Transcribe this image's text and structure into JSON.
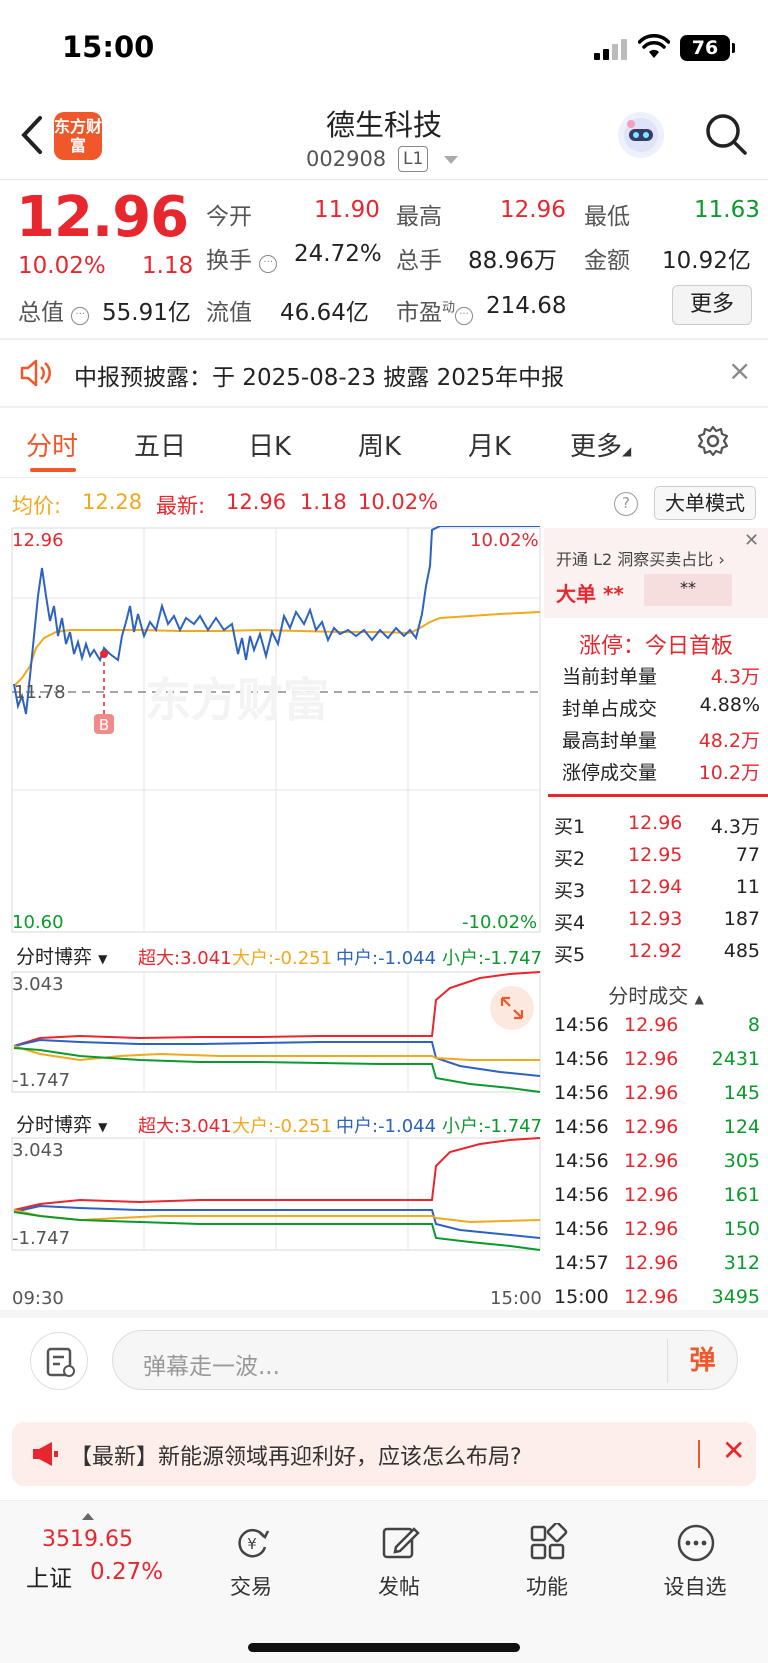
{
  "status": {
    "time": "15:00",
    "battery": "76"
  },
  "header": {
    "name": "德生科技",
    "code": "002908",
    "level": "L1",
    "logo": "东方财富"
  },
  "quote": {
    "price": "12.96",
    "pct": "10.02%",
    "change": "1.18",
    "open_label": "今开",
    "open": "11.90",
    "high_label": "最高",
    "high": "12.96",
    "low_label": "最低",
    "low": "11.63",
    "turnover_label": "换手",
    "turnover": "24.72%",
    "volume_label": "总手",
    "volume": "88.96万",
    "amount_label": "金额",
    "amount": "10.92亿",
    "mcap_label": "总值",
    "mcap": "55.91亿",
    "float_label": "流值",
    "float": "46.64亿",
    "pe_label": "市盈",
    "pe_sup": "动",
    "pe": "214.68",
    "more": "更多"
  },
  "notice": {
    "text": "中报预披露：于 2025-08-23 披露 2025年中报"
  },
  "tabs": [
    "分时",
    "五日",
    "日K",
    "周K",
    "月K",
    "更多"
  ],
  "info": {
    "avg_label": "均价:",
    "avg": "12.28",
    "latest_label": "最新:",
    "latest": "12.96",
    "chg": "1.18",
    "pct": "10.02%",
    "mode": "大单模式"
  },
  "chart": {
    "top_price": "12.96",
    "top_pct": "10.02%",
    "bottom_price": "10.60",
    "bottom_pct": "-10.02%",
    "mid_label": "11.78",
    "watermark": "东方财富",
    "marker": "B",
    "start_time": "09:30",
    "end_time": "15:00"
  },
  "flow": {
    "title": "分时博弈",
    "super": "超大:3.041",
    "large": "大户:-0.251",
    "mid": "中户:-1.044",
    "small": "小户:-1.747",
    "max": "3.043",
    "min": "-1.747"
  },
  "panel": {
    "l2_title": "开通 L2 洞察买卖占比",
    "big_order": "大单",
    "mask1": "**",
    "mask2": "**",
    "limit_title": "涨停：今日首板",
    "limit_rows": [
      {
        "label": "当前封单量",
        "value": "4.3万"
      },
      {
        "label": "封单占成交",
        "value": "4.88%"
      },
      {
        "label": "最高封单量",
        "value": "48.2万"
      },
      {
        "label": "涨停成交量",
        "value": "10.2万"
      }
    ],
    "bids": [
      {
        "label": "买1",
        "price": "12.96",
        "qty": "4.3万"
      },
      {
        "label": "买2",
        "price": "12.95",
        "qty": "77"
      },
      {
        "label": "买3",
        "price": "12.94",
        "qty": "11"
      },
      {
        "label": "买4",
        "price": "12.93",
        "qty": "187"
      },
      {
        "label": "买5",
        "price": "12.92",
        "qty": "485"
      }
    ],
    "trades_title": "分时成交",
    "trades": [
      {
        "time": "14:56",
        "price": "12.96",
        "qty": "8"
      },
      {
        "time": "14:56",
        "price": "12.96",
        "qty": "2431"
      },
      {
        "time": "14:56",
        "price": "12.96",
        "qty": "145"
      },
      {
        "time": "14:56",
        "price": "12.96",
        "qty": "124"
      },
      {
        "time": "14:56",
        "price": "12.96",
        "qty": "305"
      },
      {
        "time": "14:56",
        "price": "12.96",
        "qty": "161"
      },
      {
        "time": "14:56",
        "price": "12.96",
        "qty": "150"
      },
      {
        "time": "14:57",
        "price": "12.96",
        "qty": "312"
      },
      {
        "time": "15:00",
        "price": "12.96",
        "qty": "3495"
      }
    ]
  },
  "comment": {
    "placeholder": "弹幕走一波...",
    "dan": "弹"
  },
  "ad": {
    "text": "【最新】新能源领域再迎利好，应该怎么布局?"
  },
  "nav": {
    "index_value": "3519.65",
    "index_name": "上证",
    "index_pct": "0.27%",
    "items": [
      "交易",
      "发帖",
      "功能",
      "设自选"
    ]
  }
}
